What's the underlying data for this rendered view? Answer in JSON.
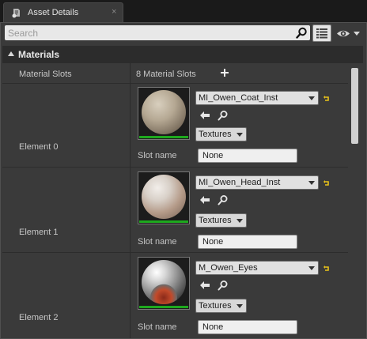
{
  "tab": {
    "title": "Asset Details",
    "close": "×",
    "icon": "asset-details-icon"
  },
  "search": {
    "placeholder": "Search",
    "value": ""
  },
  "section": {
    "title": "Materials"
  },
  "material_slots": {
    "label": "Material Slots",
    "count_text": "8 Material Slots"
  },
  "elements": [
    {
      "label": "Element 0",
      "material": "MI_Owen_Coat_Inst",
      "textures": "Textures",
      "slot_label": "Slot name",
      "slot_value": "None"
    },
    {
      "label": "Element 1",
      "material": "MI_Owen_Head_Inst",
      "textures": "Textures",
      "slot_label": "Slot name",
      "slot_value": "None"
    },
    {
      "label": "Element 2",
      "material": "M_Owen_Eyes",
      "textures": "Textures",
      "slot_label": "Slot name",
      "slot_value": "None"
    }
  ],
  "colors": {
    "accent_reset": "#e8c21a",
    "thumb_bar": "#1ea91e",
    "panel": "#3a3a3a"
  }
}
